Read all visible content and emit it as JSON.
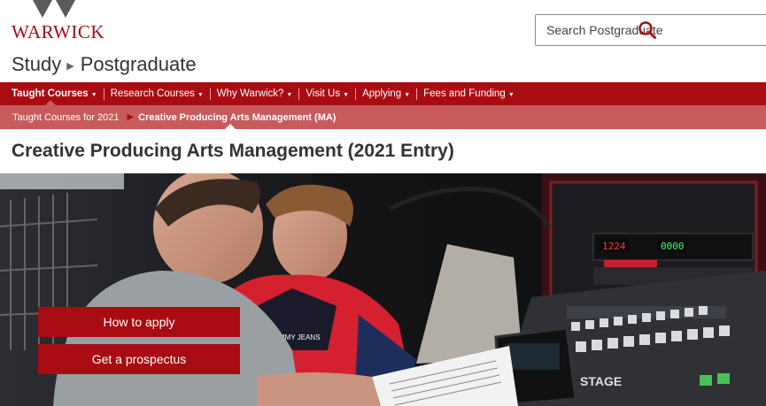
{
  "brand": {
    "name": "WARWICK",
    "color": "#a80c12"
  },
  "search": {
    "placeholder": "Search Postgraduate",
    "icon": "search-icon"
  },
  "site": {
    "section": "Study",
    "subsection": "Postgraduate"
  },
  "nav": {
    "items": [
      {
        "label": "Taught Courses"
      },
      {
        "label": "Research Courses"
      },
      {
        "label": "Why Warwick?"
      },
      {
        "label": "Visit Us"
      },
      {
        "label": "Applying"
      },
      {
        "label": "Fees and Funding"
      }
    ]
  },
  "subnav": {
    "parent": "Taught Courses for 2021",
    "current": "Creative Producing Arts Management (MA)"
  },
  "page": {
    "title": "Creative Producing Arts Management (2021 Entry)"
  },
  "hero": {
    "shirt_text": "MMY JEANS",
    "console_display_1": "1224",
    "console_display_2": "0000",
    "console_brand": "STAGE"
  },
  "cta": {
    "apply": "How to apply",
    "prospectus": "Get a prospectus"
  }
}
